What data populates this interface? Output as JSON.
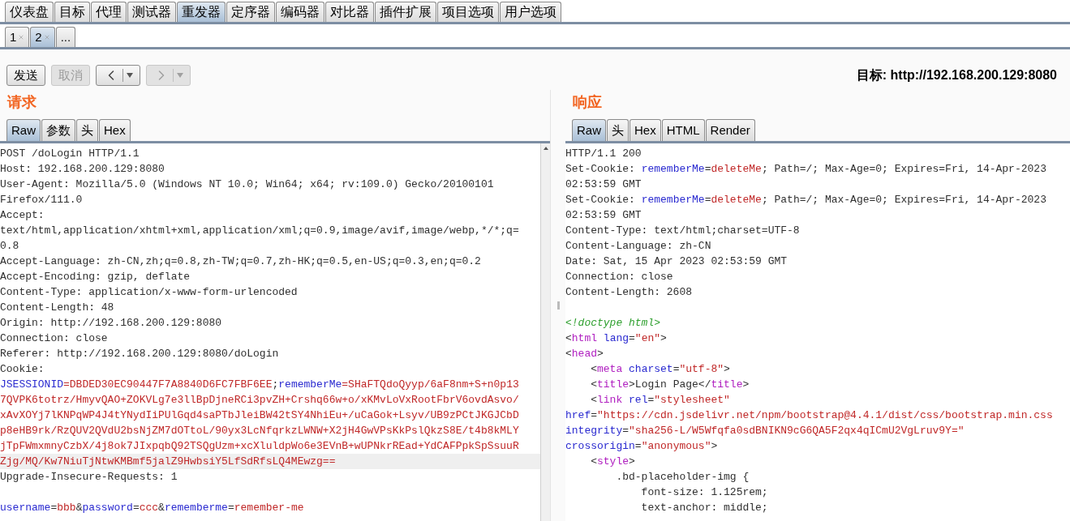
{
  "main_tabs": [
    {
      "label": "仪表盘",
      "selected": false
    },
    {
      "label": "目标",
      "selected": false
    },
    {
      "label": "代理",
      "selected": false
    },
    {
      "label": "测试器",
      "selected": false
    },
    {
      "label": "重发器",
      "selected": true
    },
    {
      "label": "定序器",
      "selected": false
    },
    {
      "label": "编码器",
      "selected": false
    },
    {
      "label": "对比器",
      "selected": false
    },
    {
      "label": "插件扩展",
      "selected": false
    },
    {
      "label": "项目选项",
      "selected": false
    },
    {
      "label": "用户选项",
      "selected": false
    }
  ],
  "repeater_tabs": [
    {
      "label": "1",
      "selected": false,
      "closable": true
    },
    {
      "label": "2",
      "selected": true,
      "closable": true
    },
    {
      "label": "...",
      "selected": false,
      "closable": false
    }
  ],
  "toolbar": {
    "send": {
      "label": "发送",
      "disabled": false
    },
    "cancel": {
      "label": "取消",
      "disabled": true
    },
    "back": {
      "disabled": false
    },
    "forward": {
      "disabled": true
    },
    "target": "目标: http://192.168.200.129:8080"
  },
  "request": {
    "heading": "请求",
    "tabs": [
      {
        "label": "Raw",
        "selected": true
      },
      {
        "label": "参数",
        "selected": false
      },
      {
        "label": "头",
        "selected": false
      },
      {
        "label": "Hex",
        "selected": false
      }
    ],
    "lines": [
      {
        "highlighted": false,
        "segments": [
          {
            "kind": "plain",
            "text": "POST /doLogin HTTP/1.1"
          }
        ]
      },
      {
        "highlighted": false,
        "segments": [
          {
            "kind": "plain",
            "text": "Host: 192.168.200.129:8080"
          }
        ]
      },
      {
        "highlighted": false,
        "segments": [
          {
            "kind": "plain",
            "text": "User-Agent: Mozilla/5.0 (Windows NT 10.0; Win64; x64; rv:109.0) Gecko/20100101"
          }
        ]
      },
      {
        "highlighted": false,
        "segments": [
          {
            "kind": "plain",
            "text": "Firefox/111.0"
          }
        ]
      },
      {
        "highlighted": false,
        "segments": [
          {
            "kind": "plain",
            "text": "Accept:"
          }
        ]
      },
      {
        "highlighted": false,
        "segments": [
          {
            "kind": "plain",
            "text": "text/html,application/xhtml+xml,application/xml;q=0.9,image/avif,image/webp,*/*;q="
          }
        ]
      },
      {
        "highlighted": false,
        "segments": [
          {
            "kind": "plain",
            "text": "0.8"
          }
        ]
      },
      {
        "highlighted": false,
        "segments": [
          {
            "kind": "plain",
            "text": "Accept-Language: zh-CN,zh;q=0.8,zh-TW;q=0.7,zh-HK;q=0.5,en-US;q=0.3,en;q=0.2"
          }
        ]
      },
      {
        "highlighted": false,
        "segments": [
          {
            "kind": "plain",
            "text": "Accept-Encoding: gzip, deflate"
          }
        ]
      },
      {
        "highlighted": false,
        "segments": [
          {
            "kind": "plain",
            "text": "Content-Type: application/x-www-form-urlencoded"
          }
        ]
      },
      {
        "highlighted": false,
        "segments": [
          {
            "kind": "plain",
            "text": "Content-Length: 48"
          }
        ]
      },
      {
        "highlighted": false,
        "segments": [
          {
            "kind": "plain",
            "text": "Origin: http://192.168.200.129:8080"
          }
        ]
      },
      {
        "highlighted": false,
        "segments": [
          {
            "kind": "plain",
            "text": "Connection: close"
          }
        ]
      },
      {
        "highlighted": false,
        "segments": [
          {
            "kind": "plain",
            "text": "Referer: http://192.168.200.129:8080/doLogin"
          }
        ]
      },
      {
        "highlighted": false,
        "segments": [
          {
            "kind": "plain",
            "text": "Cookie:"
          }
        ]
      },
      {
        "highlighted": false,
        "segments": [
          {
            "kind": "name",
            "text": "JSESSIONID"
          },
          {
            "kind": "value",
            "text": "=DBDED30EC90447F7A8840D6FC7FBF6EE"
          },
          {
            "kind": "plain",
            "text": ";"
          },
          {
            "kind": "name",
            "text": "rememberMe"
          },
          {
            "kind": "value",
            "text": "=SHaFTQdoQyyp/6aF8nm+S+n0p13"
          }
        ]
      },
      {
        "highlighted": false,
        "segments": [
          {
            "kind": "value",
            "text": "7QVPK6totrz/HmyvQAO+ZOKVLg7e3llBpDjneRCi3pvZH+Crshq66w+o/xKMvLoVxRootFbrV6ovdAsvo/"
          }
        ]
      },
      {
        "highlighted": false,
        "segments": [
          {
            "kind": "value",
            "text": "xAvXOYj7lKNPqWP4J4tYNydIiPUlGqd4saPTbJleiBW42tSY4NhiEu+/uCaGok+Lsyv/UB9zPCtJKGJCbD"
          }
        ]
      },
      {
        "highlighted": false,
        "segments": [
          {
            "kind": "value",
            "text": "p8eHB9rk/RzQUV2QVdU2bsNjZM7dOTtoL/90yx3LcNfqrkzLWNW+X2jH4GwVPsKkPslQkzS8E/t4b8kMLY"
          }
        ]
      },
      {
        "highlighted": false,
        "segments": [
          {
            "kind": "value",
            "text": "jTpFWmxmnyCzbX/4j8ok7JIxpqbQ92TSQgUzm+xcXluldpWo6e3EVnB+wUPNkrREad+YdCAFPpkSpSsuuR"
          }
        ]
      },
      {
        "highlighted": true,
        "segments": [
          {
            "kind": "value",
            "text": "Zjg/MQ/Kw7NiuTjNtwKMBmf5jalZ9HwbsiY5LfSdRfsLQ4MEwzg=="
          }
        ]
      },
      {
        "highlighted": false,
        "segments": [
          {
            "kind": "plain",
            "text": "Upgrade-Insecure-Requests: 1"
          }
        ]
      },
      {
        "highlighted": false
      },
      {
        "highlighted": false,
        "segments": [
          {
            "kind": "name",
            "text": "username"
          },
          {
            "kind": "plain",
            "text": "="
          },
          {
            "kind": "value",
            "text": "bbb"
          },
          {
            "kind": "plain",
            "text": "&"
          },
          {
            "kind": "name",
            "text": "password"
          },
          {
            "kind": "plain",
            "text": "="
          },
          {
            "kind": "value",
            "text": "ccc"
          },
          {
            "kind": "plain",
            "text": "&"
          },
          {
            "kind": "name",
            "text": "rememberme"
          },
          {
            "kind": "plain",
            "text": "="
          },
          {
            "kind": "value",
            "text": "remember-me"
          }
        ]
      }
    ]
  },
  "response": {
    "heading": "响应",
    "tabs": [
      {
        "label": "Raw",
        "selected": true
      },
      {
        "label": "头",
        "selected": false
      },
      {
        "label": "Hex",
        "selected": false
      },
      {
        "label": "HTML",
        "selected": false
      },
      {
        "label": "Render",
        "selected": false
      }
    ],
    "lines": [
      {
        "highlighted": false,
        "segments": [
          {
            "kind": "plain",
            "text": "HTTP/1.1 200"
          }
        ]
      },
      {
        "highlighted": false,
        "segments": [
          {
            "kind": "plain",
            "text": "Set-Cookie: "
          },
          {
            "kind": "name",
            "text": "rememberMe"
          },
          {
            "kind": "plain",
            "text": "="
          },
          {
            "kind": "value",
            "text": "deleteMe"
          },
          {
            "kind": "plain",
            "text": "; Path=/; Max-Age=0; Expires=Fri, 14-Apr-2023"
          }
        ]
      },
      {
        "highlighted": false,
        "segments": [
          {
            "kind": "plain",
            "text": "02:53:59 GMT"
          }
        ]
      },
      {
        "highlighted": false,
        "segments": [
          {
            "kind": "plain",
            "text": "Set-Cookie: "
          },
          {
            "kind": "name",
            "text": "rememberMe"
          },
          {
            "kind": "plain",
            "text": "="
          },
          {
            "kind": "value",
            "text": "deleteMe"
          },
          {
            "kind": "plain",
            "text": "; Path=/; Max-Age=0; Expires=Fri, 14-Apr-2023"
          }
        ]
      },
      {
        "highlighted": false,
        "segments": [
          {
            "kind": "plain",
            "text": "02:53:59 GMT"
          }
        ]
      },
      {
        "highlighted": false,
        "segments": [
          {
            "kind": "plain",
            "text": "Content-Type: text/html;charset=UTF-8"
          }
        ]
      },
      {
        "highlighted": false,
        "segments": [
          {
            "kind": "plain",
            "text": "Content-Language: zh-CN"
          }
        ]
      },
      {
        "highlighted": false,
        "segments": [
          {
            "kind": "plain",
            "text": "Date: Sat, 15 Apr 2023 02:53:59 GMT"
          }
        ]
      },
      {
        "highlighted": false,
        "segments": [
          {
            "kind": "plain",
            "text": "Connection: close"
          }
        ]
      },
      {
        "highlighted": false,
        "segments": [
          {
            "kind": "plain",
            "text": "Content-Length: 2608"
          }
        ]
      },
      {
        "highlighted": false
      },
      {
        "highlighted": false,
        "segments": [
          {
            "kind": "comment",
            "text": "<!doctype html>"
          }
        ]
      },
      {
        "highlighted": false,
        "segments": [
          {
            "kind": "plain",
            "text": "<"
          },
          {
            "kind": "tag",
            "text": "html"
          },
          {
            "kind": "name",
            "text": " lang"
          },
          {
            "kind": "plain",
            "text": "="
          },
          {
            "kind": "value",
            "text": "\"en\""
          },
          {
            "kind": "plain",
            "text": ">"
          }
        ]
      },
      {
        "highlighted": false,
        "segments": [
          {
            "kind": "plain",
            "text": "<"
          },
          {
            "kind": "tag",
            "text": "head"
          },
          {
            "kind": "plain",
            "text": ">"
          }
        ]
      },
      {
        "highlighted": false,
        "segments": [
          {
            "kind": "plain",
            "text": "    <"
          },
          {
            "kind": "tag",
            "text": "meta"
          },
          {
            "kind": "name",
            "text": " charset"
          },
          {
            "kind": "plain",
            "text": "="
          },
          {
            "kind": "value",
            "text": "\"utf-8\""
          },
          {
            "kind": "plain",
            "text": ">"
          }
        ]
      },
      {
        "highlighted": false,
        "segments": [
          {
            "kind": "plain",
            "text": "    <"
          },
          {
            "kind": "tag",
            "text": "title"
          },
          {
            "kind": "plain",
            "text": ">Login Page</"
          },
          {
            "kind": "tag",
            "text": "title"
          },
          {
            "kind": "plain",
            "text": ">"
          }
        ]
      },
      {
        "highlighted": false,
        "segments": [
          {
            "kind": "plain",
            "text": "    <"
          },
          {
            "kind": "tag",
            "text": "link"
          },
          {
            "kind": "name",
            "text": " rel"
          },
          {
            "kind": "plain",
            "text": "="
          },
          {
            "kind": "value",
            "text": "\"stylesheet\""
          }
        ]
      },
      {
        "highlighted": false,
        "segments": [
          {
            "kind": "name",
            "text": "href"
          },
          {
            "kind": "plain",
            "text": "="
          },
          {
            "kind": "value",
            "text": "\"https://cdn.jsdelivr.net/npm/bootstrap@4.4.1/dist/css/bootstrap.min.css"
          }
        ]
      },
      {
        "highlighted": false,
        "segments": [
          {
            "kind": "name",
            "text": "integrity"
          },
          {
            "kind": "plain",
            "text": "="
          },
          {
            "kind": "value",
            "text": "\"sha256-L/W5Wfqfa0sdBNIKN9cG6QA5F2qx4qICmU2VgLruv9Y=\""
          }
        ]
      },
      {
        "highlighted": false,
        "segments": [
          {
            "kind": "name",
            "text": "crossorigin"
          },
          {
            "kind": "plain",
            "text": "="
          },
          {
            "kind": "value",
            "text": "\"anonymous\""
          },
          {
            "kind": "plain",
            "text": ">"
          }
        ]
      },
      {
        "highlighted": false,
        "segments": [
          {
            "kind": "plain",
            "text": "    <"
          },
          {
            "kind": "tag",
            "text": "style"
          },
          {
            "kind": "plain",
            "text": ">"
          }
        ]
      },
      {
        "highlighted": false,
        "segments": [
          {
            "kind": "plain",
            "text": "        .bd-placeholder-img {"
          }
        ]
      },
      {
        "highlighted": false,
        "segments": [
          {
            "kind": "plain",
            "text": "            font-size: 1.125rem;"
          }
        ]
      },
      {
        "highlighted": false,
        "segments": [
          {
            "kind": "plain",
            "text": "            text-anchor: middle;"
          }
        ]
      }
    ]
  }
}
